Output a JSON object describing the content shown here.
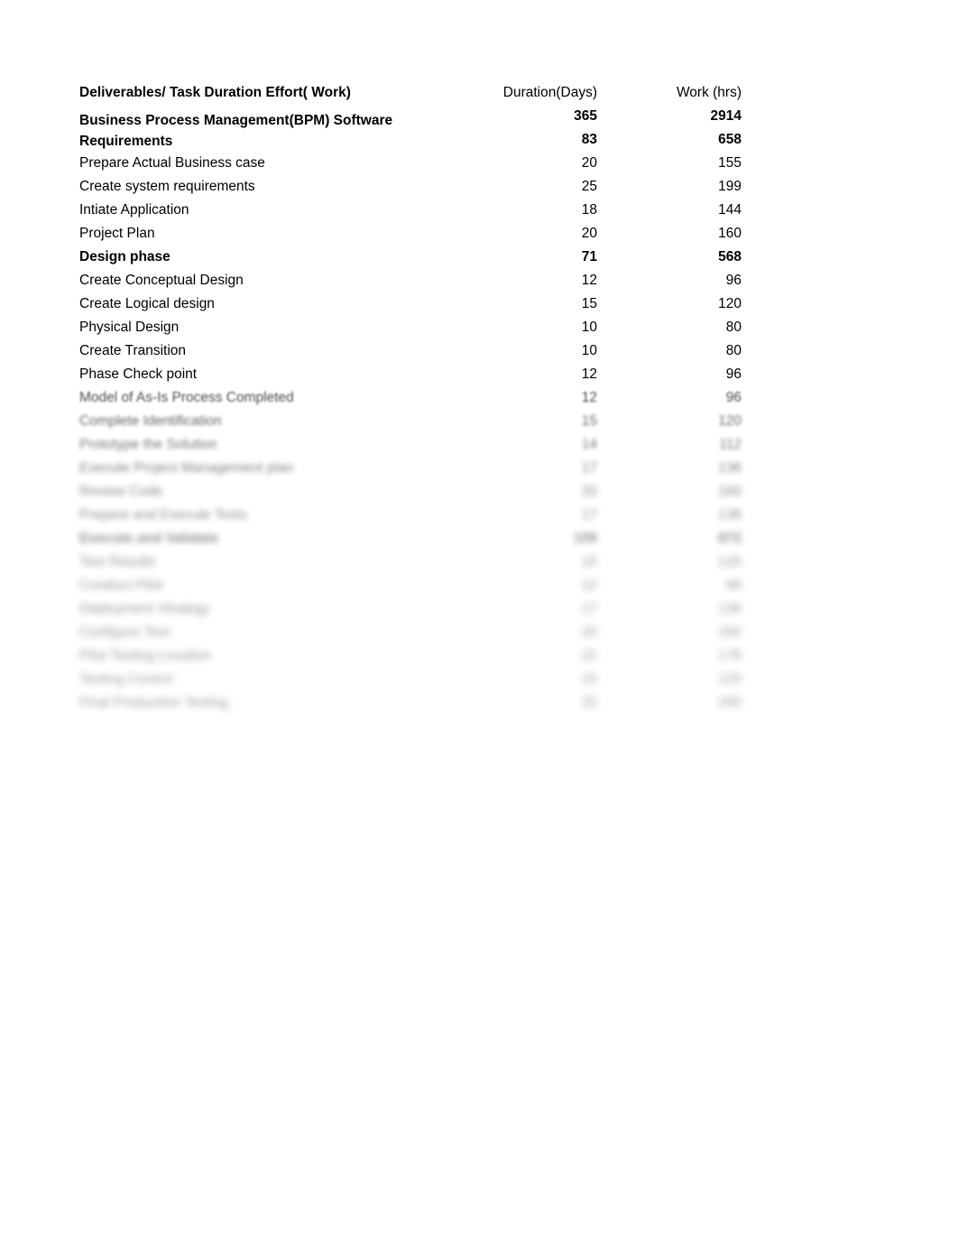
{
  "table": {
    "headers": {
      "task": "Deliverables/ Task Duration Effort( Work)",
      "duration": "Duration(Days)",
      "work": "Work (hrs)"
    },
    "rows": [
      {
        "task_line1": "Business Process Management(BPM) Software",
        "task_line2": "Requirements",
        "duration": "365",
        "work": "2914",
        "duration2": "83",
        "work2": "658",
        "bold": true,
        "blur": 0
      },
      {
        "task": "Prepare Actual Business case",
        "duration": "20",
        "work": "155",
        "bold": false,
        "blur": 0
      },
      {
        "task": "Create system requirements",
        "duration": "25",
        "work": "199",
        "bold": false,
        "blur": 0
      },
      {
        "task": "Intiate Application",
        "duration": "18",
        "work": "144",
        "bold": false,
        "blur": 0
      },
      {
        "task": "Project Plan",
        "duration": "20",
        "work": "160",
        "bold": false,
        "blur": 0
      },
      {
        "task": "Design phase",
        "duration": "71",
        "work": "568",
        "bold": true,
        "blur": 0
      },
      {
        "task": "Create Conceptual Design",
        "duration": "12",
        "work": "96",
        "bold": false,
        "blur": 0
      },
      {
        "task": "Create Logical design",
        "duration": "15",
        "work": "120",
        "bold": false,
        "blur": 0
      },
      {
        "task": "Physical Design",
        "duration": "10",
        "work": "80",
        "bold": false,
        "blur": 0
      },
      {
        "task": "Create Transition",
        "duration": "10",
        "work": "80",
        "bold": false,
        "blur": 0
      },
      {
        "task": "Phase Check point",
        "duration": "12",
        "work": "96",
        "bold": false,
        "blur": 0
      },
      {
        "task": "Model of As-Is Process Completed",
        "duration": "12",
        "work": "96",
        "bold": false,
        "blur": 1
      },
      {
        "task": "Complete Identification",
        "duration": "15",
        "work": "120",
        "bold": false,
        "blur": 2
      },
      {
        "task": "Prototype the Solution",
        "duration": "14",
        "work": "112",
        "bold": false,
        "blur": 3
      },
      {
        "task": "Execute Project Management plan",
        "duration": "17",
        "work": "136",
        "bold": false,
        "blur": 4
      },
      {
        "task": "Review Code",
        "duration": "20",
        "work": "160",
        "bold": false,
        "blur": 5
      },
      {
        "task": "Prepare and Execute Tests",
        "duration": "17",
        "work": "136",
        "bold": false,
        "blur": 6
      },
      {
        "task": "Execute and Validate",
        "duration": "109",
        "work": "872",
        "bold": true,
        "blur": 7
      },
      {
        "task": "Test Results",
        "duration": "15",
        "work": "120",
        "bold": false,
        "blur": 8
      },
      {
        "task": "Conduct Pilot",
        "duration": "12",
        "work": "96",
        "bold": false,
        "blur": 9
      },
      {
        "task": "Deployment Strategy",
        "duration": "17",
        "work": "136",
        "bold": false,
        "blur": 10
      },
      {
        "task": "Configure Test",
        "duration": "20",
        "work": "160",
        "bold": false,
        "blur": 11
      },
      {
        "task": "Pilot Testing Location",
        "duration": "22",
        "work": "176",
        "bold": false,
        "blur": 12
      },
      {
        "task": "Testing Control",
        "duration": "15",
        "work": "120",
        "bold": false,
        "blur": 13
      },
      {
        "task": "Final Production Testing",
        "duration": "25",
        "work": "200",
        "bold": false,
        "blur": 14
      }
    ]
  }
}
